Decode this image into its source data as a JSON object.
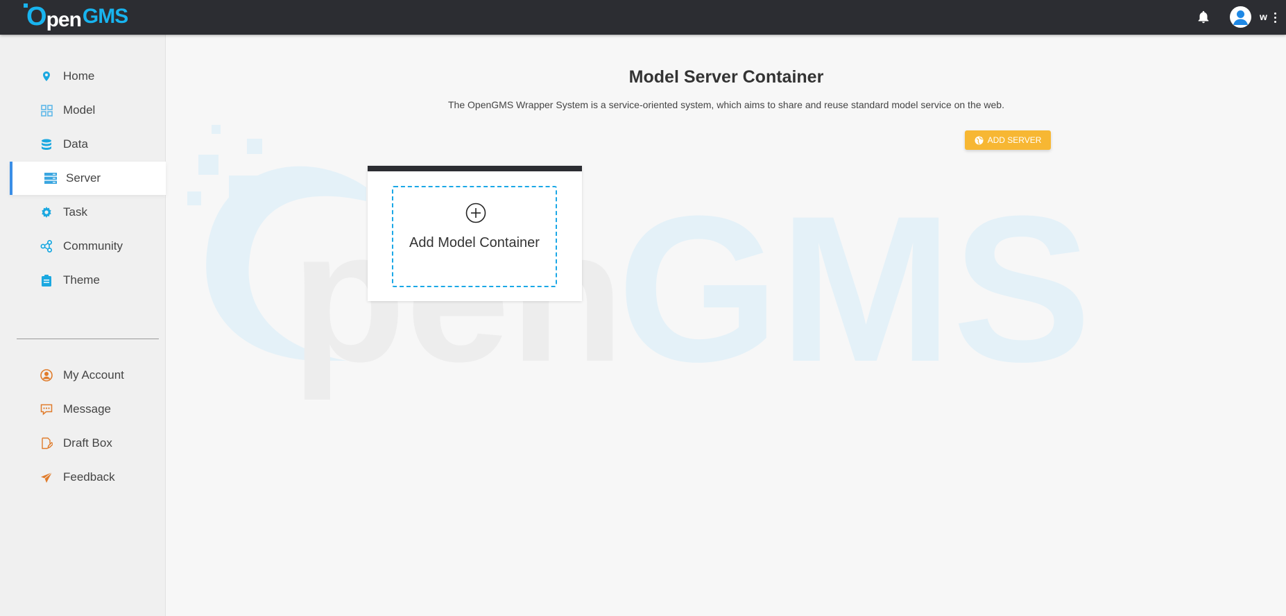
{
  "header": {
    "logo": {
      "o": "O",
      "pen": "pen",
      "gms": "GMS"
    },
    "username": "w",
    "icons": {
      "notifications": "bell-icon",
      "avatar": "user-avatar-icon",
      "menu": "more-vertical-icon"
    }
  },
  "sidebar": {
    "items": [
      {
        "label": "Home",
        "icon": "location-icon"
      },
      {
        "label": "Model",
        "icon": "grid-icon"
      },
      {
        "label": "Data",
        "icon": "database-icon"
      },
      {
        "label": "Server",
        "icon": "server-icon",
        "active": true
      },
      {
        "label": "Task",
        "icon": "gear-icon"
      },
      {
        "label": "Community",
        "icon": "share-network-icon"
      },
      {
        "label": "Theme",
        "icon": "clipboard-icon"
      }
    ],
    "account_items": [
      {
        "label": "My Account",
        "icon": "user-circle-icon"
      },
      {
        "label": "Message",
        "icon": "message-icon"
      },
      {
        "label": "Draft Box",
        "icon": "edit-note-icon"
      },
      {
        "label": "Feedback",
        "icon": "paper-plane-icon"
      }
    ]
  },
  "main": {
    "title": "Model Server Container",
    "description": "The OpenGMS Wrapper System is a service-oriented system, which aims to share and reuse standard model service on the web.",
    "add_server_label": "ADD SERVER",
    "add_container_label": "Add Model Container",
    "watermark": {
      "pen": "pen",
      "gms": "GMS"
    }
  },
  "colors": {
    "topbar": "#2c2d32",
    "brand": "#18b4ef",
    "sidebar_accent": "#3a8ee6",
    "add_server": "#f7b733",
    "account_icon": "#e07b2a"
  }
}
